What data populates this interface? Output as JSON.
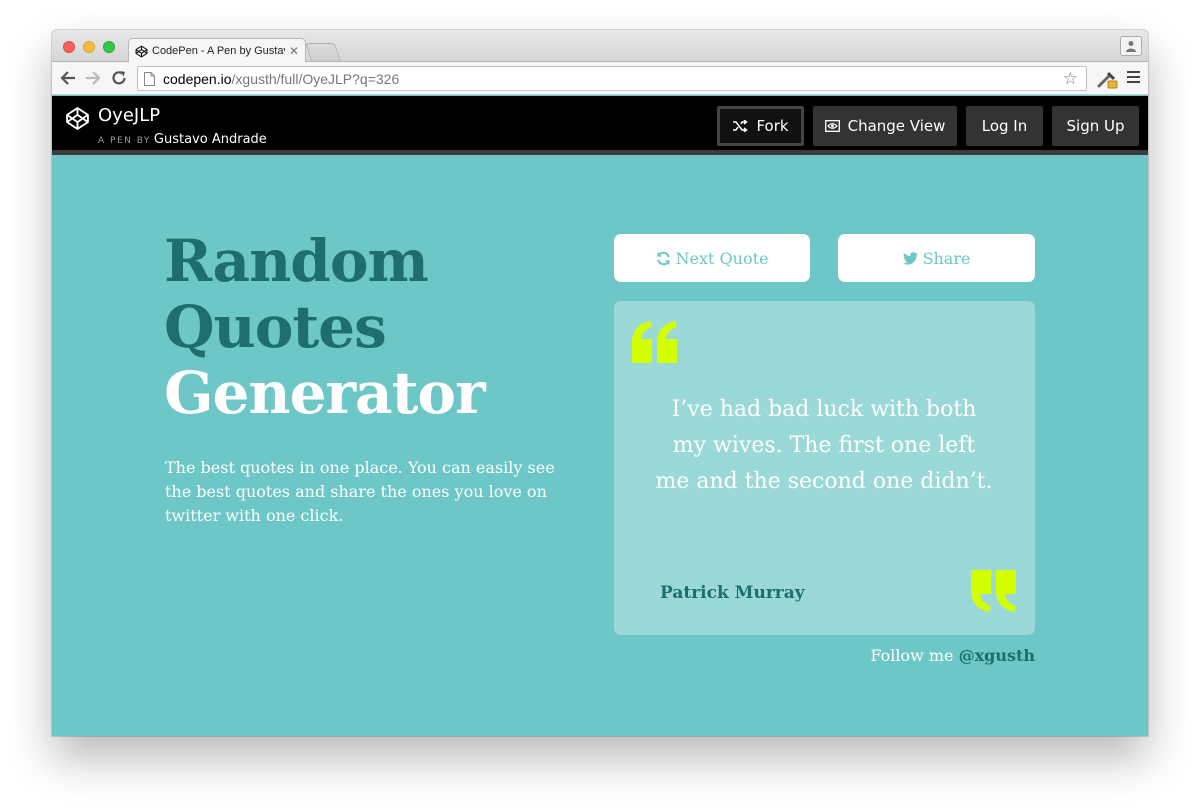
{
  "browser": {
    "tab_title": "CodePen - A Pen by Gustavo",
    "url_domain": "codepen.io",
    "url_path": "/xgusth/full/OyeJLP?q=326"
  },
  "codepen": {
    "pen_title": "OyeJLP",
    "by_label": "A PEN BY",
    "author": "Gustavo Andrade",
    "fork_label": "Fork",
    "change_view_label": "Change View",
    "login_label": "Log In",
    "signup_label": "Sign Up"
  },
  "hero": {
    "title_line1": "Random",
    "title_line2": "Quotes",
    "title_line3": "Generator",
    "description": "The best quotes in one place. You can easily see the best quotes and share the ones you love on twitter with one click."
  },
  "actions": {
    "next_label": "Next Quote",
    "share_label": "Share"
  },
  "quote": {
    "text": "I’ve had bad luck with both my wives. The first one left me and the second one didn’t.",
    "author": "Patrick Murray"
  },
  "footer": {
    "follow_prefix": "Follow me",
    "handle": "@xgusth"
  },
  "colors": {
    "background": "#6dc7c7",
    "card": "#9bd9d9",
    "accent_dark": "#1d6e6c",
    "quote_marks": "#d4ff00",
    "header": "#000000"
  },
  "icons": {
    "next": "refresh-icon",
    "share": "twitter-bird-icon",
    "fork": "fork-icon",
    "view": "eye-icon"
  }
}
